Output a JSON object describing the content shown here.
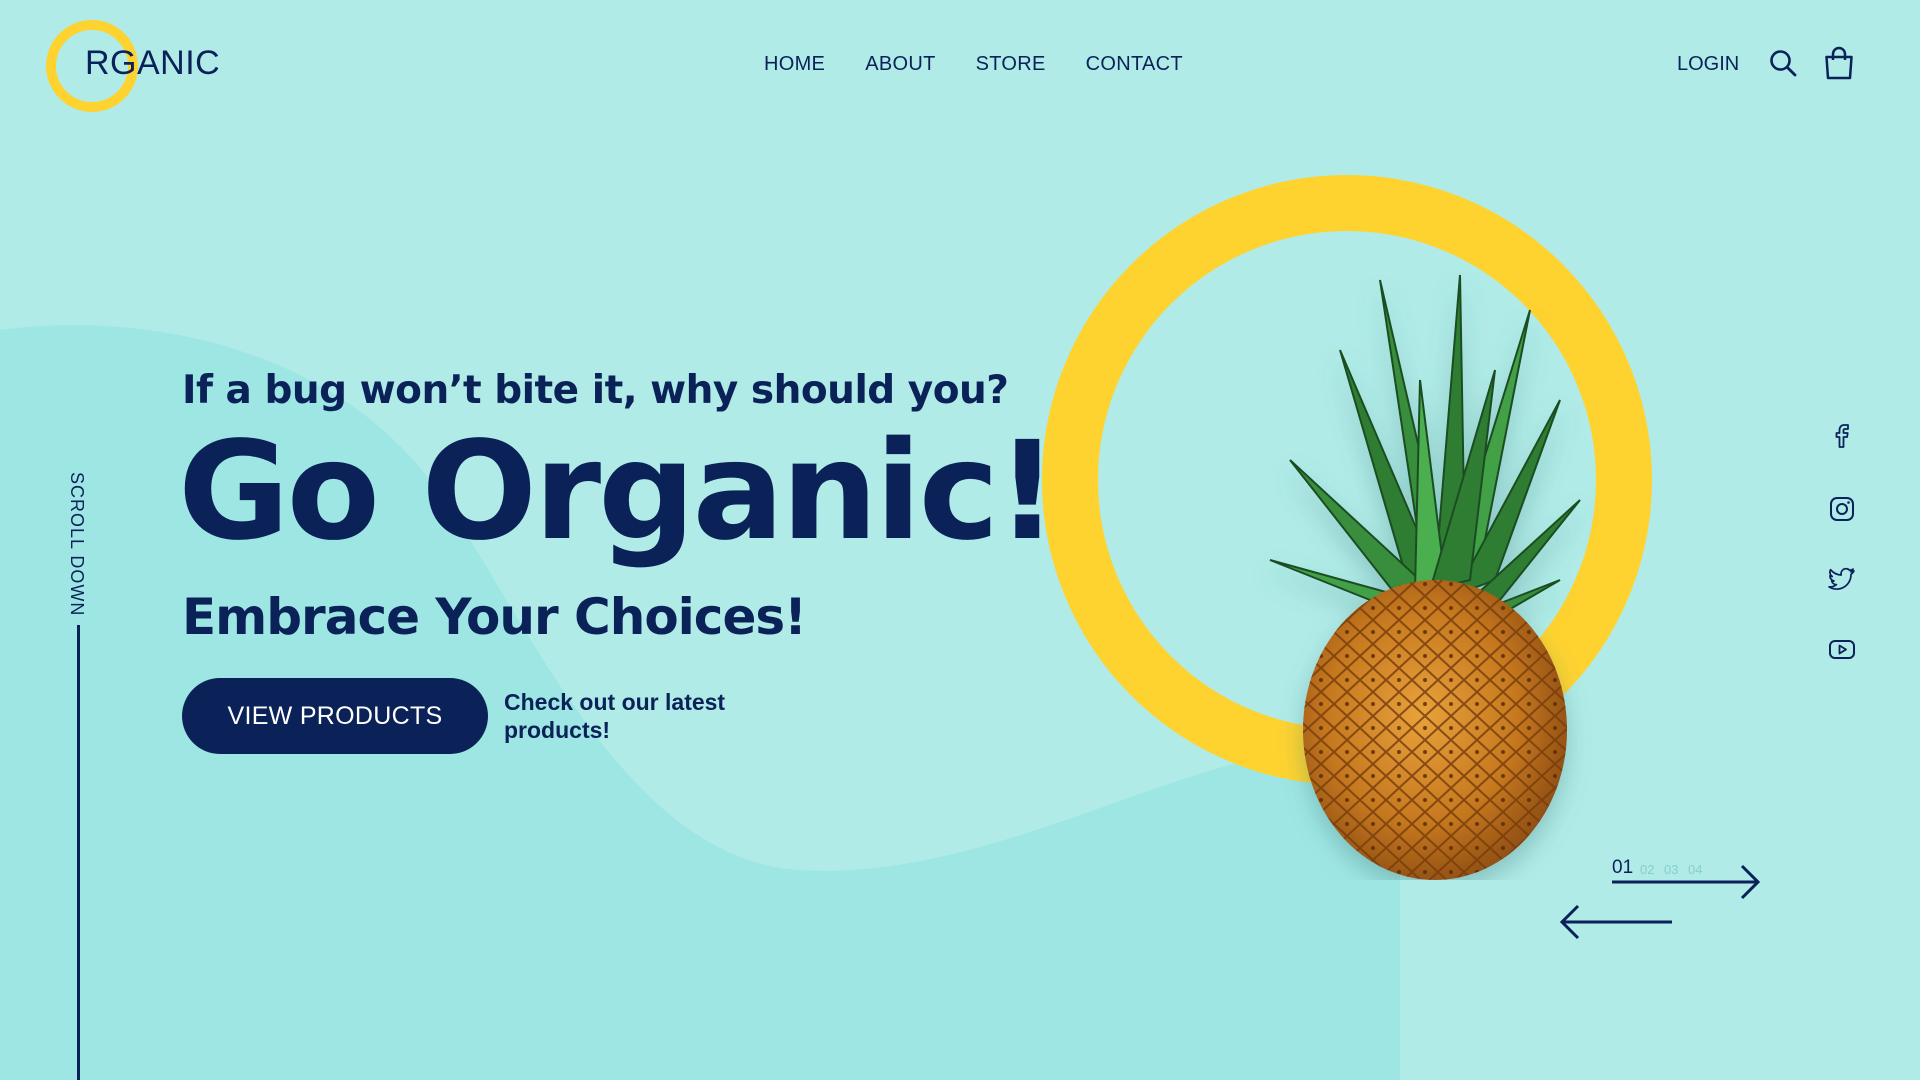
{
  "colors": {
    "background": "#b0ebe7",
    "wave": "#9ee6e4",
    "accent": "#fed330",
    "primary": "#0b2259"
  },
  "header": {
    "logo_text": "RGANIC",
    "nav": [
      "HOME",
      "ABOUT",
      "STORE",
      "CONTACT"
    ],
    "login": "LOGIN",
    "icons": [
      "search-icon",
      "shopping-bag-icon"
    ]
  },
  "hero": {
    "tagline": "If a bug won’t bite it, why should you?",
    "headline": "Go Organic!",
    "subheadline": "Embrace Your Choices!",
    "cta_label": "VIEW PRODUCTS",
    "cta_note": "Check out our latest products!",
    "image": "pineapple-image"
  },
  "scroll": {
    "label": "SCROLL DOWN"
  },
  "social": [
    "facebook-icon",
    "instagram-icon",
    "twitter-icon",
    "youtube-icon"
  ],
  "slider": {
    "current": "01",
    "others": [
      "02",
      "03",
      "04"
    ]
  }
}
